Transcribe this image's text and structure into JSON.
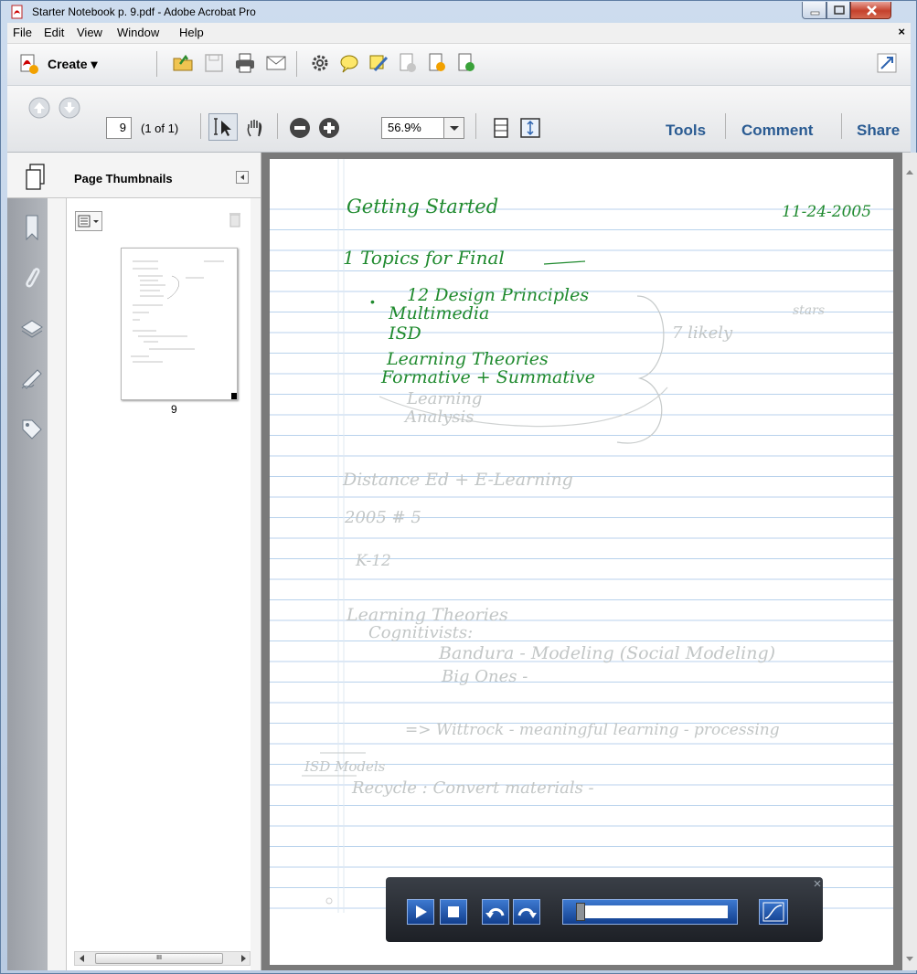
{
  "window": {
    "title": "Starter Notebook p. 9.pdf - Adobe Acrobat Pro"
  },
  "menu": {
    "items": [
      "File",
      "Edit",
      "View",
      "Window",
      "Help"
    ],
    "close": "×"
  },
  "toolbar1": {
    "create_label": "Create ▾"
  },
  "toolbar2": {
    "page_number": "9",
    "page_of": "(1 of 1)",
    "zoom": "56.9%",
    "tools": "Tools",
    "comment": "Comment",
    "share": "Share"
  },
  "nav": {
    "panel_title": "Page Thumbnails",
    "thumbnail_label": "9",
    "hscroll_thumb": "III"
  },
  "notes": {
    "title": "Getting Started",
    "date": "11-24-2005",
    "topics": "1 Topics for Final",
    "lines": [
      "12 Design Principles",
      "Multimedia",
      "ISD",
      "Learning Theories",
      "Formative + Summative"
    ],
    "faint_lines": [
      "Learning",
      "Analysis"
    ],
    "likely": "7 likely",
    "stars": "stars",
    "distance": "Distance Ed  +  E-Learning",
    "year": "2005     # 5",
    "k12": "K-12",
    "theories_title": "Learning Theories",
    "cognitivists": "Cognitivists:",
    "bandura": "Bandura -  Modeling  (Social Modeling)",
    "big_ones": "Big Ones -",
    "wittrock": "=> Wittrock - meaningful learning - processing",
    "isd_models": "ISD Models",
    "recycle": "Recycle :    Convert materials -"
  },
  "colors": {
    "ink": "#1f8a2e",
    "faint_ink": "#b9bdbd",
    "rule_line": "#b8d2ec",
    "margin_line": "#dfe8f2"
  }
}
